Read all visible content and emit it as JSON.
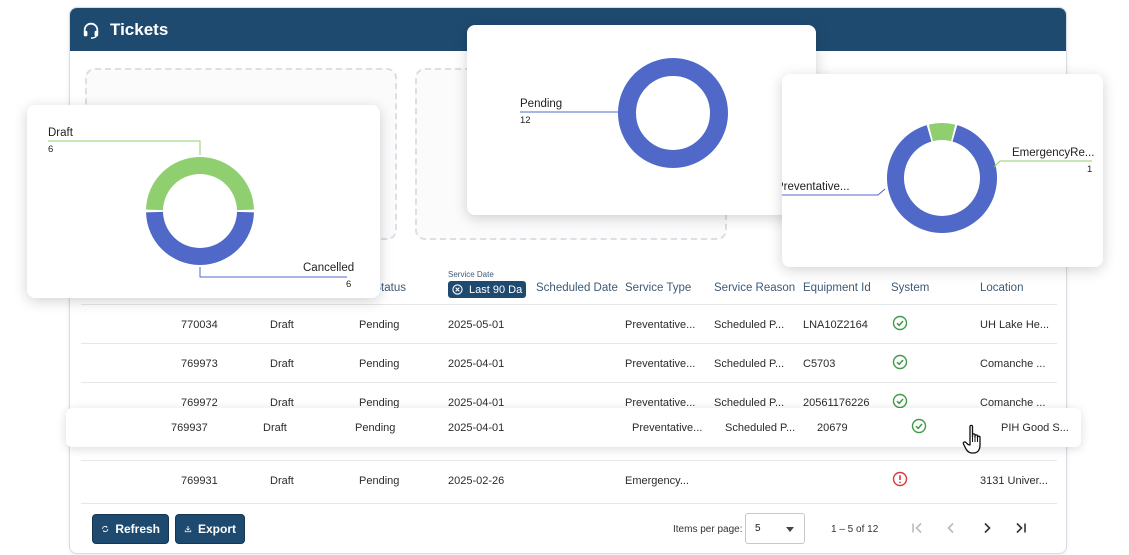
{
  "header": {
    "title": "Tickets",
    "icon": "headset-icon"
  },
  "table": {
    "columns": {
      "ticket_status_partial": "t Status",
      "service_date_label": "Service Date",
      "service_date_filter": "Last 90 Da",
      "scheduled_date": "Scheduled Date",
      "service_type": "Service Type",
      "service_reason": "Service Reason",
      "equipment_id": "Equipment Id",
      "system": "System",
      "location": "Location"
    },
    "rows": [
      {
        "id": "770034",
        "status": "Draft",
        "ticket_status": "Pending",
        "service_date": "2025-05-01",
        "scheduled_date": "",
        "service_type": "Preventative...",
        "service_reason": "Scheduled P...",
        "equipment_id": "LNA10Z2164",
        "system": "ok",
        "location": "UH Lake He..."
      },
      {
        "id": "769973",
        "status": "Draft",
        "ticket_status": "Pending",
        "service_date": "2025-04-01",
        "scheduled_date": "",
        "service_type": "Preventative...",
        "service_reason": "Scheduled P...",
        "equipment_id": "C5703",
        "system": "ok",
        "location": "Comanche ..."
      },
      {
        "id": "769972",
        "status": "Draft",
        "ticket_status": "Pending",
        "service_date": "2025-04-01",
        "scheduled_date": "",
        "service_type": "Preventative...",
        "service_reason": "Scheduled P...",
        "equipment_id": "20561176226",
        "system": "ok",
        "location": "Comanche ..."
      },
      {
        "id": "769931",
        "status": "Draft",
        "ticket_status": "Pending",
        "service_date": "2025-02-26",
        "scheduled_date": "",
        "service_type": "Emergency...",
        "service_reason": "",
        "equipment_id": "",
        "system": "error",
        "location": "3131 Univer..."
      }
    ],
    "highlighted_row": {
      "id": "769937",
      "status": "Draft",
      "ticket_status": "Pending",
      "service_date": "2025-04-01",
      "service_type": "Preventative...",
      "service_reason": "Scheduled P...",
      "equipment_id": "20679",
      "system": "ok",
      "location": "PIH Good S..."
    }
  },
  "footer": {
    "refresh_label": "Refresh",
    "export_label": "Export",
    "items_per_page_label": "Items per page:",
    "items_per_page_value": "5",
    "range_label": "1 – 5 of 12"
  },
  "colors": {
    "header": "#1f4a70",
    "blue": "#5068c8",
    "green": "#8fcf6f",
    "ok": "#3f9b4a",
    "error": "#d9383a"
  },
  "chart_data": [
    {
      "type": "pie",
      "variant": "donut",
      "slices": [
        {
          "label": "Draft",
          "value": 6,
          "color": "#8fcf6f"
        },
        {
          "label": "Cancelled",
          "value": 6,
          "color": "#5068c8"
        }
      ]
    },
    {
      "type": "pie",
      "variant": "donut",
      "slices": [
        {
          "label": "Pending",
          "value": 12,
          "color": "#5068c8"
        }
      ]
    },
    {
      "type": "pie",
      "variant": "donut",
      "slices": [
        {
          "label": "Preventative...",
          "value": 11,
          "color": "#5068c8"
        },
        {
          "label": "EmergencyRe...",
          "value": 1,
          "color": "#8fcf6f"
        }
      ]
    }
  ]
}
